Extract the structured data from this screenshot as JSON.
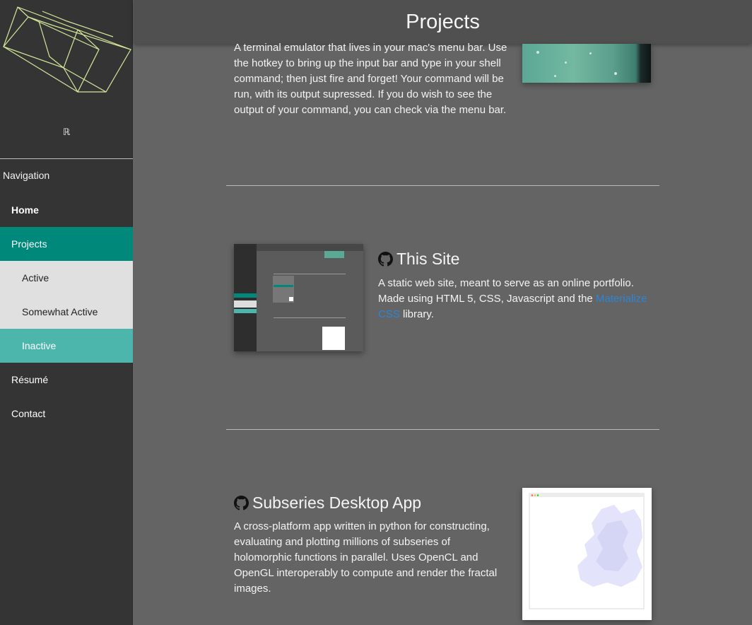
{
  "header": {
    "title": "Projects"
  },
  "sidebar": {
    "mark": "ℝ",
    "nav_header": "Navigation",
    "items": [
      {
        "label": "Home"
      },
      {
        "label": "Projects"
      },
      {
        "label": "Active"
      },
      {
        "label": "Somewhat Active"
      },
      {
        "label": "Inactive"
      },
      {
        "label": "Résumé"
      },
      {
        "label": "Contact"
      }
    ]
  },
  "projects": [
    {
      "description": "A terminal emulator that lives in your mac's menu bar. Use the hotkey to bring up the input bar and type in your shell command; then just fire and forget! Your command will be run, with its output supressed. If you do wish to see the output of your command, you can check via the menu bar."
    },
    {
      "title": "This Site",
      "desc_before": "A static web site, meant to serve as an online portfolio. Made using HTML 5, CSS, Javascript and the ",
      "link_text": "Materialize CSS",
      "desc_after": " library."
    },
    {
      "title": "Subseries Desktop App",
      "description": "A cross-platform app written in python for constructing, evaluating and plotting millions of subseries of holomorphic functions in parallel. Uses OpenCL and OpenGL interoperably to compute and render the fractal images."
    }
  ],
  "colors": {
    "accent": "#00897b",
    "accent_light": "#4db6ac",
    "link": "#2a86d8",
    "sidebar_bg": "#343434",
    "content_bg": "#646464"
  },
  "icons": [
    "wireframe-cube-logo",
    "github-icon"
  ]
}
